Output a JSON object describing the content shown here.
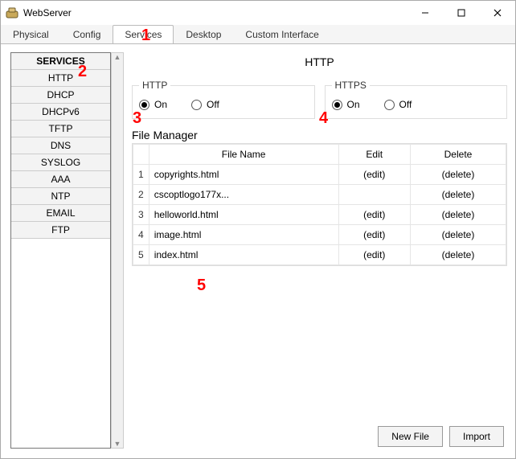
{
  "window": {
    "title": "WebServer"
  },
  "tabs": {
    "physical": "Physical",
    "config": "Config",
    "services": "Services",
    "desktop": "Desktop",
    "custom": "Custom Interface"
  },
  "sidebar": {
    "header": "SERVICES",
    "items": [
      "HTTP",
      "DHCP",
      "DHCPv6",
      "TFTP",
      "DNS",
      "SYSLOG",
      "AAA",
      "NTP",
      "EMAIL",
      "FTP"
    ]
  },
  "page": {
    "title": "HTTP"
  },
  "http_fs": {
    "legend": "HTTP",
    "on": "On",
    "off": "Off"
  },
  "https_fs": {
    "legend": "HTTPS",
    "on": "On",
    "off": "Off"
  },
  "filemanager": {
    "title": "File Manager",
    "headers": {
      "filename": "File Name",
      "edit": "Edit",
      "delete": "Delete"
    },
    "rows": [
      {
        "n": "1",
        "name": "copyrights.html",
        "edit": "(edit)",
        "del": "(delete)"
      },
      {
        "n": "2",
        "name": "cscoptlogo177x...",
        "edit": "",
        "del": "(delete)"
      },
      {
        "n": "3",
        "name": "helloworld.html",
        "edit": "(edit)",
        "del": "(delete)"
      },
      {
        "n": "4",
        "name": "image.html",
        "edit": "(edit)",
        "del": "(delete)"
      },
      {
        "n": "5",
        "name": "index.html",
        "edit": "(edit)",
        "del": "(delete)"
      }
    ]
  },
  "buttons": {
    "newfile": "New File",
    "import": "Import"
  },
  "annotations": {
    "a1": "1",
    "a2": "2",
    "a3": "3",
    "a4": "4",
    "a5": "5"
  }
}
